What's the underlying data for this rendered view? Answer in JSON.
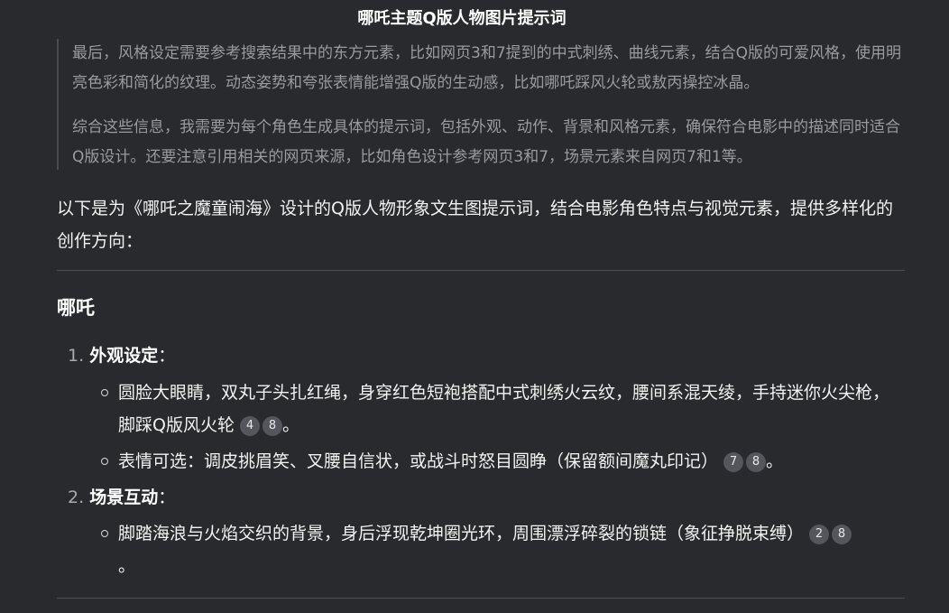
{
  "title": "哪吒主题Q版人物图片提示词",
  "thinking": {
    "paragraph1": "最后，风格设定需要参考搜索结果中的东方元素，比如网页3和7提到的中式刺绣、曲线元素，结合Q版的可爱风格，使用明亮色彩和简化的纹理。动态姿势和夸张表情能增强Q版的生动感，比如哪吒踩风火轮或敖丙操控冰晶。",
    "paragraph2": "综合这些信息，我需要为每个角色生成具体的提示词，包括外观、动作、背景和风格元素，确保符合电影中的描述同时适合Q版设计。还要注意引用相关的网页来源，比如角色设计参考网页3和7，场景元素来自网页7和1等。"
  },
  "intro": "以下是为《哪吒之魔童闹海》设计的Q版人物形象文生图提示词，结合电影角色特点与视觉元素，提供多样化的创作方向：",
  "section": {
    "heading": "哪吒",
    "items": [
      {
        "number": "1.",
        "label": "外观设定",
        "colon": "：",
        "bullets": [
          {
            "text": "圆脸大眼睛，双丸子头扎红绳，身穿红色短袍搭配中式刺绣火云纹，腰间系混天绫，手持迷你火尖枪，脚踩Q版风火轮",
            "citations": [
              "4",
              "8"
            ],
            "end": "。"
          },
          {
            "text": "表情可选：调皮挑眉笑、叉腰自信状，或战斗时怒目圆睁（保留额间魔丸印记）",
            "citations": [
              "7",
              "8"
            ],
            "end": "。"
          }
        ]
      },
      {
        "number": "2.",
        "label": "场景互动",
        "colon": "：",
        "bullets": [
          {
            "text": "脚踏海浪与火焰交织的背景，身后浮现乾坤圈光环，周围漂浮碎裂的锁链（象征挣脱束缚）",
            "citations": [
              "2",
              "8"
            ],
            "end": "。"
          }
        ]
      }
    ]
  }
}
